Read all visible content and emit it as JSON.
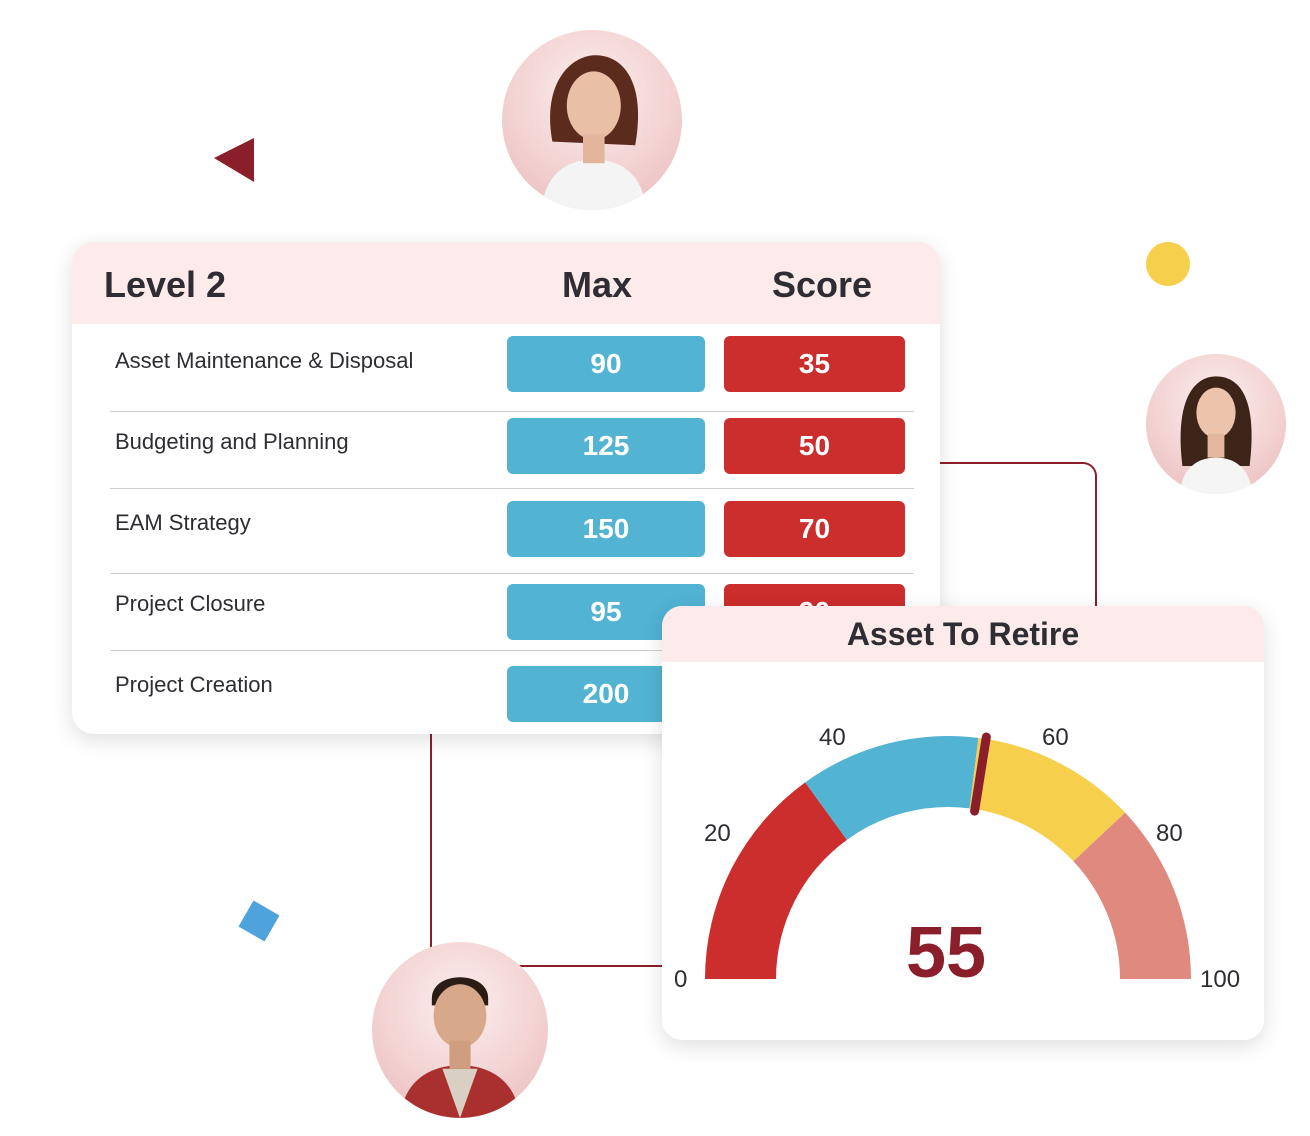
{
  "table": {
    "title": "Level 2",
    "max_header": "Max",
    "score_header": "Score",
    "rows": [
      {
        "label": "Asset Maintenance & Disposal",
        "max": "90",
        "score": "35"
      },
      {
        "label": "Budgeting and Planning",
        "max": "125",
        "score": "50"
      },
      {
        "label": "EAM Strategy",
        "max": "150",
        "score": "70"
      },
      {
        "label": "Project Closure",
        "max": "95",
        "score": "90"
      },
      {
        "label": "Project Creation",
        "max": "200",
        "score": ""
      }
    ]
  },
  "gauge": {
    "title": "Asset To Retire",
    "value": "55",
    "ticks": [
      "0",
      "20",
      "40",
      "60",
      "80",
      "100"
    ],
    "min": 0,
    "max": 100,
    "needle": 55,
    "segments": [
      {
        "from": 0,
        "to": 30,
        "color": "#cc2d2d"
      },
      {
        "from": 30,
        "to": 54,
        "color": "#52b3d3"
      },
      {
        "from": 54,
        "to": 76,
        "color": "#f6d04d"
      },
      {
        "from": 76,
        "to": 100,
        "color": "#e0897e"
      }
    ]
  },
  "colors": {
    "accent": "#8a1f2b",
    "max_pill": "#52b3d3",
    "score_pill": "#cc2d2d",
    "header_bg": "#fdeaea"
  }
}
